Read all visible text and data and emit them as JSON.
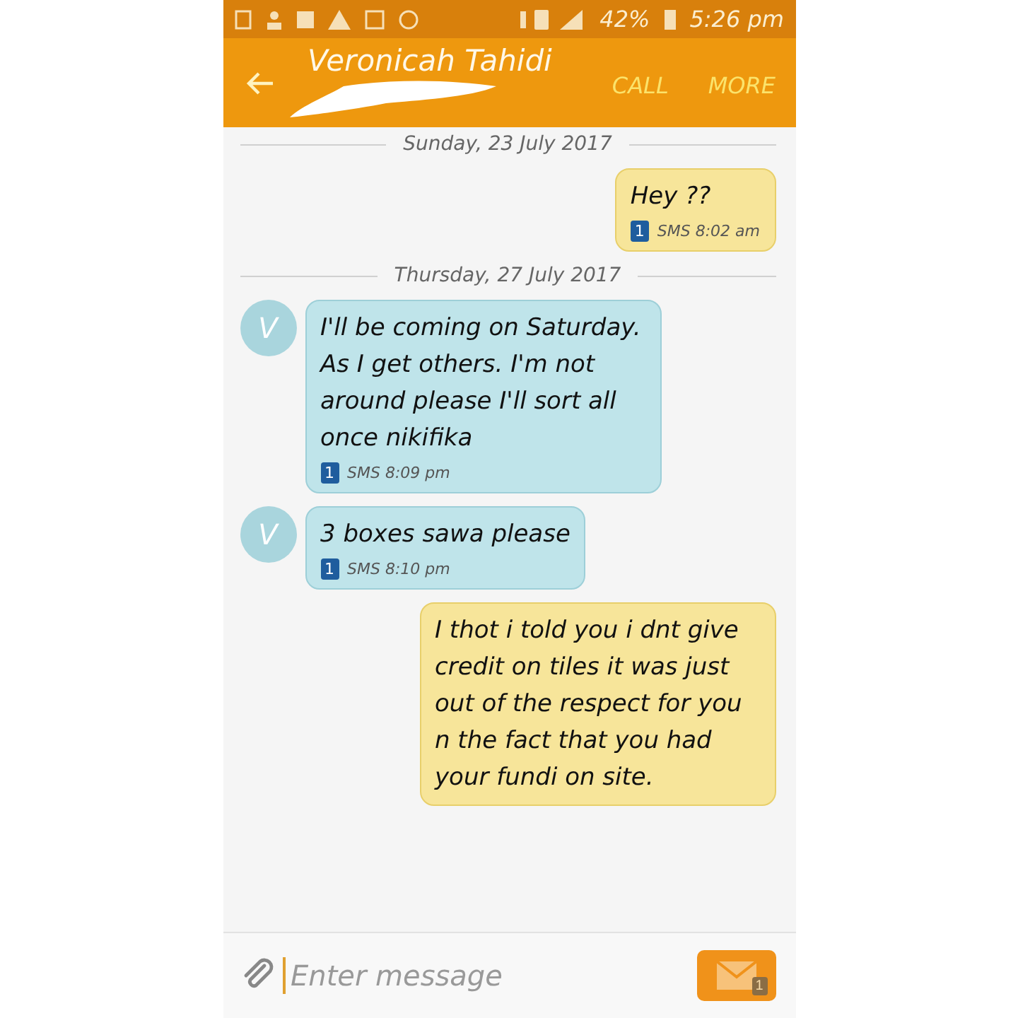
{
  "status_bar": {
    "battery": "42%",
    "time": "5:26 pm"
  },
  "header": {
    "contact": "Veronicah Tahidi",
    "actions": [
      "CALL",
      "MORE"
    ]
  },
  "messages": [
    {
      "kind": "date",
      "text": "Sunday, 23 July 2017"
    },
    {
      "kind": "outgoing",
      "text": "Hey ??",
      "sim": "1",
      "meta": "SMS 8:02 am"
    },
    {
      "kind": "date",
      "text": "Thursday, 27 July 2017"
    },
    {
      "kind": "incoming",
      "avatar": "V",
      "text": "I'll be coming on Saturday. As I get others. I'm not around please I'll sort all once nikifika",
      "sim": "1",
      "meta": "SMS 8:09 pm"
    },
    {
      "kind": "incoming",
      "avatar": "V",
      "text": "3 boxes sawa please",
      "sim": "1",
      "meta": "SMS 8:10 pm"
    },
    {
      "kind": "outgoing",
      "text": "I thot i told you i dnt give credit on tiles it was just out of the respect for you n the fact that you had your fundi on site."
    }
  ],
  "composer": {
    "placeholder": "Enter message",
    "sim": "1"
  }
}
